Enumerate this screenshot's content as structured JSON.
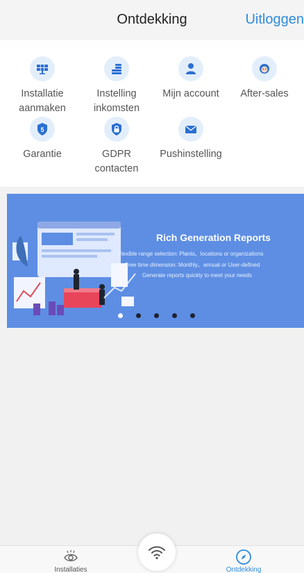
{
  "header": {
    "title": "Ontdekking",
    "logout": "Uitloggen"
  },
  "menu": {
    "items": [
      {
        "label": "Installatie aanmaken",
        "icon": "solar-panel-icon"
      },
      {
        "label": "Instelling inkomsten",
        "icon": "coins-icon"
      },
      {
        "label": "Mijn account",
        "icon": "user-icon"
      },
      {
        "label": "After-sales",
        "icon": "support-agent-icon"
      },
      {
        "label": "Garantie",
        "icon": "warranty-shield-icon"
      },
      {
        "label": "GDPR contacten",
        "icon": "lock-shield-icon"
      },
      {
        "label": "Pushinstelling",
        "icon": "envelope-icon"
      }
    ]
  },
  "banner": {
    "title": "Rich Generation Reports",
    "lines": [
      "Flexible range selection:  Plants、locations or organizations",
      "Free time dimension:  Monthly、annual or User-defined",
      "Generate reports quickly to meet your needs"
    ],
    "slides": 5,
    "active_slide": 1
  },
  "tabbar": {
    "left_label": "Installaties",
    "right_label": "Ontdekking",
    "center_icon": "wifi-icon"
  },
  "colors": {
    "accent": "#2f8cdc",
    "banner": "#5d8ee3",
    "icon_bg": "#e3eefb"
  }
}
